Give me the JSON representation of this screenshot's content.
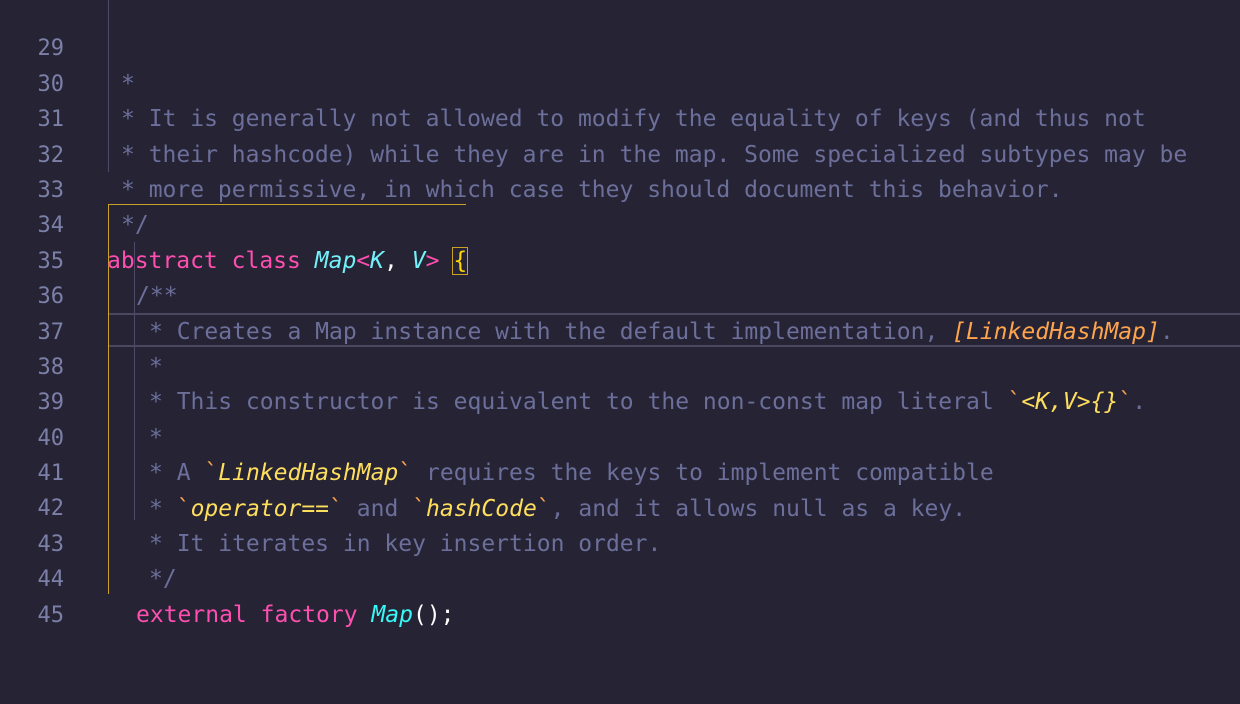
{
  "editor": {
    "lines": [
      {
        "number": "29",
        "text": "*"
      },
      {
        "number": "30",
        "text": "* It is generally not allowed to modify the equality of keys (and thus not"
      },
      {
        "number": "31",
        "text": "* their hashcode) while they are in the map. Some specialized subtypes may be"
      },
      {
        "number": "32",
        "text": "* more permissive, in which case they should document this behavior."
      },
      {
        "number": "33",
        "text": "*/"
      },
      {
        "number": "34",
        "kw1": "abstract",
        "kw2": "class",
        "type": "Map",
        "lt": "<",
        "tp1": "K",
        "comma": ",",
        "tp2": "V",
        "gt": ">",
        "brace": "{"
      },
      {
        "number": "35",
        "text": "/**"
      },
      {
        "number": "36",
        "pre": "* Creates a Map instance with the default implementation, ",
        "ref": "[LinkedHashMap]",
        "post": "."
      },
      {
        "number": "37",
        "text": "*"
      },
      {
        "number": "38",
        "pre": "* This constructor is equivalent to the non-const map literal ",
        "tick1": "`",
        "code": "<K,V>{}",
        "tick2": "`",
        "post": "."
      },
      {
        "number": "39",
        "text": "*"
      },
      {
        "number": "40",
        "pre": "* A ",
        "tick1": "`",
        "code": "LinkedHashMap",
        "tick2": "`",
        "post": " requires the keys to implement compatible"
      },
      {
        "number": "41",
        "pre": "* ",
        "tick1": "`",
        "code1": "operator==",
        "tick2": "`",
        "mid": " and ",
        "tick3": "`",
        "code2": "hashCode",
        "tick4": "`",
        "post": ", and it allows null as a key."
      },
      {
        "number": "42",
        "text": "* It iterates in key insertion order."
      },
      {
        "number": "43",
        "text": "*/"
      },
      {
        "number": "44",
        "kw1": "external",
        "kw2": "factory",
        "fn": "Map",
        "parens": "();"
      },
      {
        "number": "45",
        "text": ""
      }
    ]
  },
  "colors": {
    "background": "#262335",
    "comment": "#6b6f9a",
    "keyword": "#fe4fb0",
    "type": "#72f1f8",
    "doc_code": "#fede5d",
    "doc_ref": "#fea44c",
    "bracket_guide": "#c9a227"
  }
}
